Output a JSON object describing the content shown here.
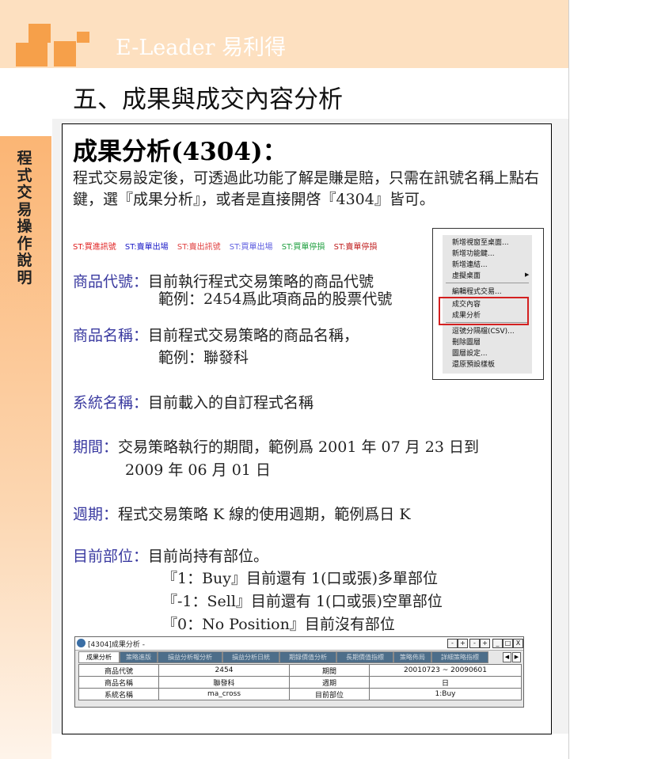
{
  "header": {
    "logo_text": "E-Leader 易利得"
  },
  "sidebar": {
    "title": "程式交易操作說明"
  },
  "section_title": "五、成果與成交內容分析",
  "heading": "成果分析(4304)：",
  "intro": "程式交易設定後，可透過此功能了解是賺是賠，只需在訊號名稱上點右鍵，選『成果分析』，或者是直接開啓『4304』皆可。",
  "legend": [
    {
      "text": "ST:買進訊號",
      "color": "#e02020"
    },
    {
      "text": "ST:賣單出場",
      "color": "#2020c8"
    },
    {
      "text": "ST:賣出訊號",
      "color": "#e04040"
    },
    {
      "text": "ST:買單出場",
      "color": "#6060e0"
    },
    {
      "text": "ST:買單停損",
      "color": "#20a040"
    },
    {
      "text": "ST:賣單停損",
      "color": "#c02020"
    }
  ],
  "fields": {
    "code_label": "商品代號：",
    "code_desc": "目前執行程式交易策略的商品代號",
    "code_example": "範例：2454爲此項商品的股票代號",
    "name_label": "商品名稱：",
    "name_desc": "目前程式交易策略的商品名稱，",
    "name_example": "範例：聯發科",
    "system_label": "系統名稱：",
    "system_desc": "目前載入的自訂程式名稱",
    "period_label": "期間：",
    "period_desc": "交易策略執行的期間，範例爲 2001 年 07 月 23 日到",
    "period_desc2": "2009 年 06 月 01 日",
    "cycle_label": "週期：",
    "cycle_desc": "程式交易策略  K  線的使用週期，範例爲日 K",
    "position_label": "目前部位：",
    "position_desc": "目前尚持有部位。",
    "position_1": "『1：Buy』目前還有  1(口或張)多單部位",
    "position_m1": "『-1：Sell』目前還有  1(口或張)空單部位",
    "position_0": "『0：No Position』目前沒有部位"
  },
  "context_menu": {
    "items": [
      "新增視窗至桌面...",
      "新增功能鍵...",
      "新增連結...",
      "虛擬桌面",
      "編輯程式交易...",
      "成交內容",
      "成果分析",
      "逗號分隔檔(CSV)...",
      "刪除圖層",
      "圖層設定...",
      "還原預設樣板"
    ]
  },
  "window": {
    "title": "[4304]成果分析 -",
    "buttons": [
      "-",
      "+",
      "-",
      "+",
      "_",
      "□",
      "X"
    ],
    "tabs": [
      "成果分析",
      "策略進版",
      "損益分析報分析",
      "損益分析日統",
      "期錄價值分析",
      "長期價值指標",
      "策略佈局",
      "詳細策略指標"
    ],
    "nav": [
      "◀",
      "▶"
    ],
    "rows": [
      [
        "商品代號",
        "2454",
        "期間",
        "20010723 ~ 20090601"
      ],
      [
        "商品名稱",
        "聯發科",
        "週期",
        "日"
      ],
      [
        "系統名稱",
        "ma_cross",
        "目前部位",
        "1:Buy"
      ]
    ]
  }
}
